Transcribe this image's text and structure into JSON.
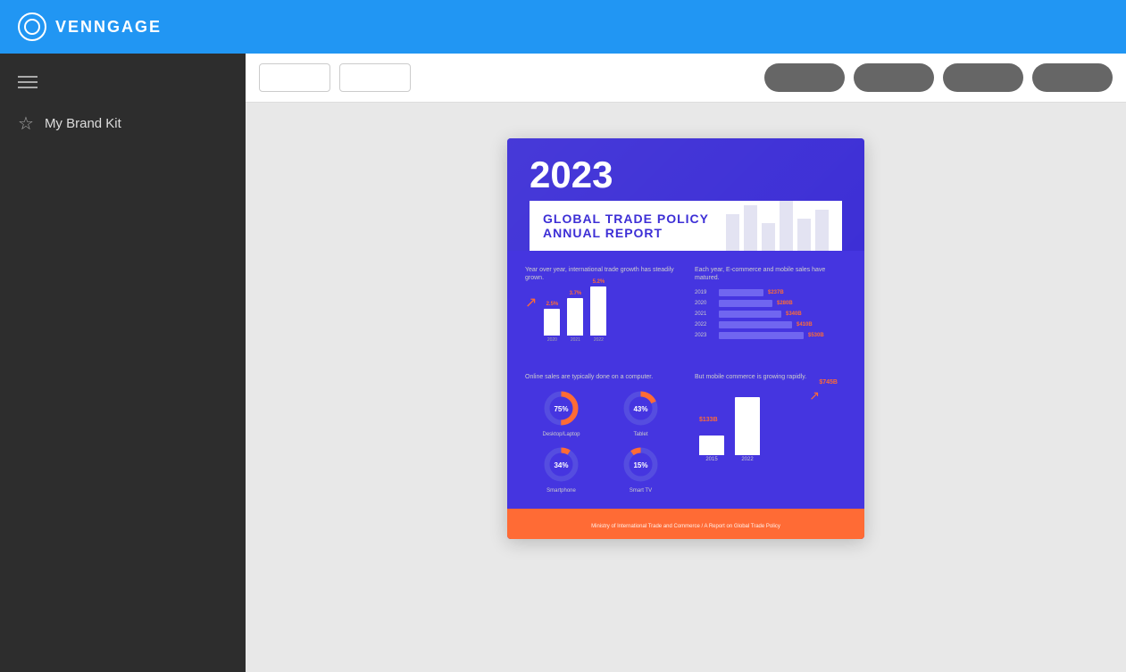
{
  "app": {
    "name": "VENNGAGE"
  },
  "toolbar": {
    "btn1_label": "",
    "btn2_label": "",
    "btn3_label": "",
    "btn4_label": "",
    "btn5_label": "",
    "btn6_label": ""
  },
  "sidebar": {
    "brand_kit_label": "My Brand Kit"
  },
  "infographic": {
    "year": "2023",
    "title_line1": "GLOBAL TRADE POLICY",
    "title_line2": "ANNUAL REPORT",
    "section1": {
      "title1": "Year over year, international trade growth has steadily grown.",
      "bars": [
        {
          "year": "2020",
          "pct": "2.5%",
          "height": 30
        },
        {
          "year": "2021",
          "pct": "3.7%",
          "height": 42
        },
        {
          "year": "2022",
          "pct": "5.2%",
          "height": 58
        }
      ]
    },
    "section2": {
      "title": "Each year, E-commerce and mobile sales have matured.",
      "rows": [
        {
          "year": "2019",
          "val": "$237B",
          "width": 40
        },
        {
          "year": "2020",
          "val": "$280B",
          "width": 52
        },
        {
          "year": "2021",
          "val": "$340B",
          "width": 62
        },
        {
          "year": "2022",
          "val": "$410B",
          "width": 74
        },
        {
          "year": "2023",
          "val": "$530B",
          "width": 86
        }
      ]
    },
    "section3": {
      "title": "Online sales are typically done on a computer.",
      "devices": [
        {
          "name": "Desktop/Laptop",
          "pct": 75,
          "color": "#ff6b35"
        },
        {
          "name": "Tablet",
          "pct": 43,
          "color": "#ff6b35"
        },
        {
          "name": "Smartphone",
          "pct": 34,
          "color": "#ff6b35"
        },
        {
          "name": "Smart TV",
          "pct": 15,
          "color": "#ff6b35"
        }
      ]
    },
    "section4": {
      "title": "But mobile commerce is growing rapidly.",
      "bars": [
        {
          "year": "2015",
          "val": "$133B",
          "height": 25
        },
        {
          "year": "2022",
          "val": "$745B",
          "height": 70
        }
      ]
    },
    "footer": "Ministry of International Trade and Commerce / A Report on Global Trade Policy"
  }
}
